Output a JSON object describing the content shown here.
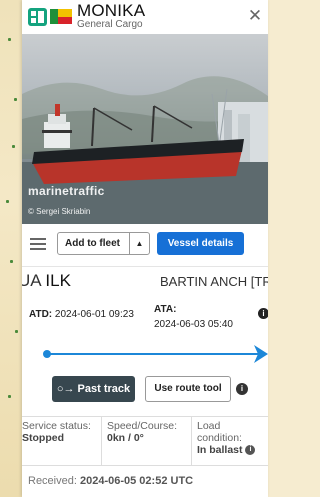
{
  "vessel": {
    "name": "MONIKA",
    "type": "General Cargo",
    "flag_colors": [
      "#1f8f3a",
      "#f2c200",
      "#d8232a"
    ],
    "type_badge_color": "#14a37f"
  },
  "photo": {
    "watermark": "marinetraffic",
    "credit": "© Sergei Skriabin"
  },
  "actions": {
    "menu_icon": "hamburger-icon",
    "add_to_fleet": "Add to fleet",
    "fleet_caret": "▲",
    "vessel_details": "Vessel details"
  },
  "route": {
    "origin_country": "UA",
    "origin_port": "ILK",
    "destination": "BARTIN ANCH [TR",
    "atd_label": "ATD:",
    "atd_value": "2024-06-01 09:23",
    "ata_label": "ATA:",
    "ata_value": "2024-06-03 05:40",
    "progress_fraction": 1.0,
    "accent_color": "#1c87d8"
  },
  "track": {
    "past_track": "Past track",
    "route_tool": "Use route tool"
  },
  "status": {
    "service_label": "Service status:",
    "service_value": "Stopped",
    "speed_label": "Speed/Course:",
    "speed_value": "0kn / 0°",
    "load_label": "Load condition:",
    "load_value": "In ballast"
  },
  "received": {
    "label": "Received:",
    "value": "2024-06-05 02:52 UTC"
  }
}
